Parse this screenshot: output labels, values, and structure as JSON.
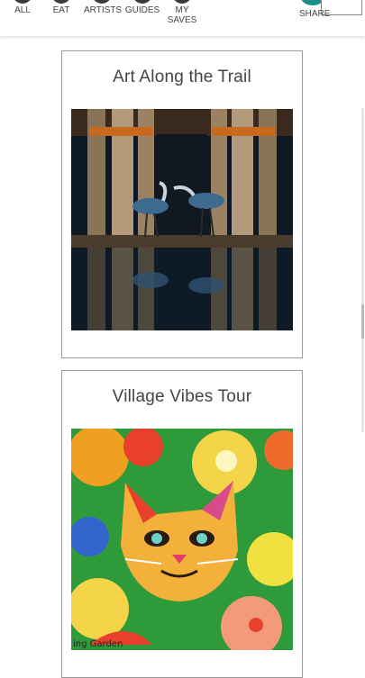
{
  "nav": {
    "items": [
      {
        "label": "ALL"
      },
      {
        "label": "EAT"
      },
      {
        "label": "ARTISTS"
      },
      {
        "label": "GUIDES"
      },
      {
        "label_line1": "MY",
        "label_line2": "SAVES"
      }
    ],
    "share_label": "SHARE"
  },
  "cards": [
    {
      "title": "Art Along the Trail"
    },
    {
      "title": "Village Vibes Tour",
      "image_caption": "ing Garden"
    }
  ],
  "colors": {
    "accent": "#1a8f86",
    "card_border": "#999999"
  }
}
